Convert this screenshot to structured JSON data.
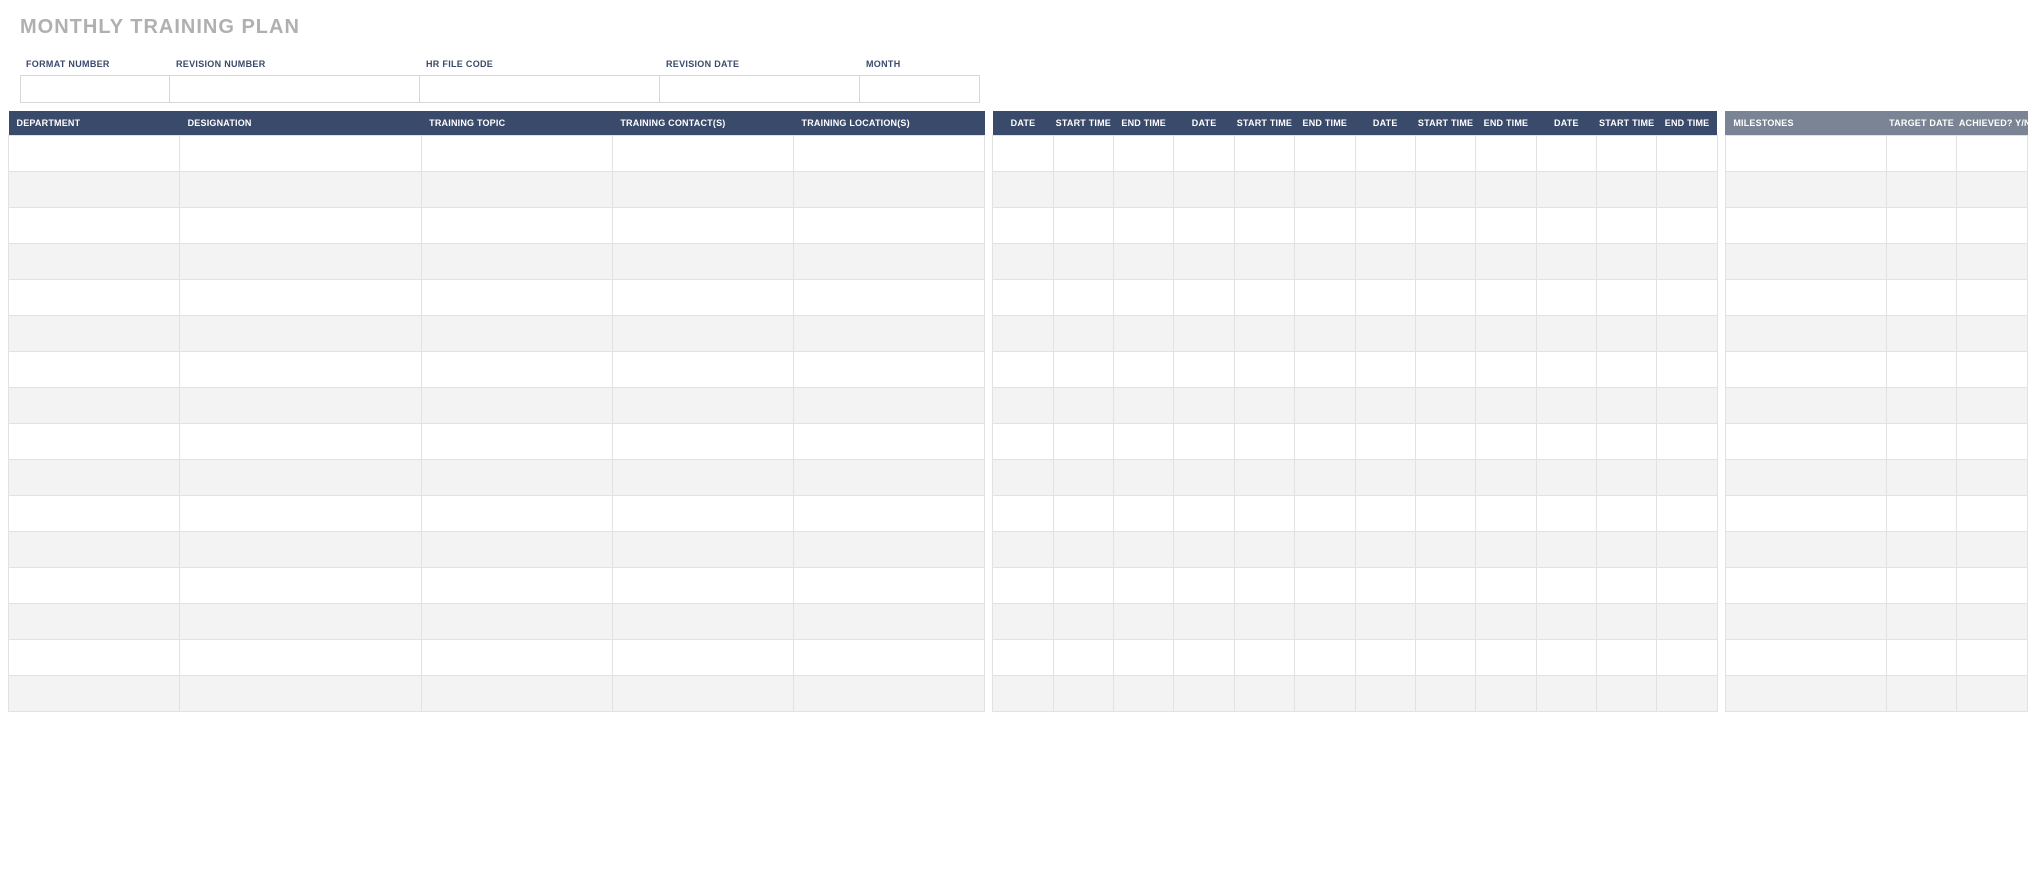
{
  "title": "MONTHLY TRAINING PLAN",
  "meta": {
    "format_number": {
      "label": "FORMAT NUMBER",
      "value": ""
    },
    "revision_number": {
      "label": "REVISION NUMBER",
      "value": ""
    },
    "hr_file_code": {
      "label": "HR FILE CODE",
      "value": ""
    },
    "revision_date": {
      "label": "REVISION DATE",
      "value": ""
    },
    "month": {
      "label": "MONTH",
      "value": ""
    }
  },
  "headers": {
    "department": "DEPARTMENT",
    "designation": "DESIGNATION",
    "training_topic": "TRAINING TOPIC",
    "training_contacts": "TRAINING CONTACT(S)",
    "training_locations": "TRAINING LOCATION(S)",
    "date": "DATE",
    "start_time": "START TIME",
    "end_time": "END TIME",
    "milestones": "MILESTONES",
    "target_date": "TARGET DATE",
    "achieved": "ACHIEVED? Y/N"
  },
  "week_blocks": 4,
  "rows": [
    {
      "department": "",
      "designation": "",
      "training_topic": "",
      "training_contacts": "",
      "training_locations": "",
      "weeks": [
        {
          "date": "",
          "start": "",
          "end": ""
        },
        {
          "date": "",
          "start": "",
          "end": ""
        },
        {
          "date": "",
          "start": "",
          "end": ""
        },
        {
          "date": "",
          "start": "",
          "end": ""
        }
      ],
      "milestones": "",
      "target_date": "",
      "achieved": ""
    },
    {
      "department": "",
      "designation": "",
      "training_topic": "",
      "training_contacts": "",
      "training_locations": "",
      "weeks": [
        {
          "date": "",
          "start": "",
          "end": ""
        },
        {
          "date": "",
          "start": "",
          "end": ""
        },
        {
          "date": "",
          "start": "",
          "end": ""
        },
        {
          "date": "",
          "start": "",
          "end": ""
        }
      ],
      "milestones": "",
      "target_date": "",
      "achieved": ""
    },
    {
      "department": "",
      "designation": "",
      "training_topic": "",
      "training_contacts": "",
      "training_locations": "",
      "weeks": [
        {
          "date": "",
          "start": "",
          "end": ""
        },
        {
          "date": "",
          "start": "",
          "end": ""
        },
        {
          "date": "",
          "start": "",
          "end": ""
        },
        {
          "date": "",
          "start": "",
          "end": ""
        }
      ],
      "milestones": "",
      "target_date": "",
      "achieved": ""
    },
    {
      "department": "",
      "designation": "",
      "training_topic": "",
      "training_contacts": "",
      "training_locations": "",
      "weeks": [
        {
          "date": "",
          "start": "",
          "end": ""
        },
        {
          "date": "",
          "start": "",
          "end": ""
        },
        {
          "date": "",
          "start": "",
          "end": ""
        },
        {
          "date": "",
          "start": "",
          "end": ""
        }
      ],
      "milestones": "",
      "target_date": "",
      "achieved": ""
    },
    {
      "department": "",
      "designation": "",
      "training_topic": "",
      "training_contacts": "",
      "training_locations": "",
      "weeks": [
        {
          "date": "",
          "start": "",
          "end": ""
        },
        {
          "date": "",
          "start": "",
          "end": ""
        },
        {
          "date": "",
          "start": "",
          "end": ""
        },
        {
          "date": "",
          "start": "",
          "end": ""
        }
      ],
      "milestones": "",
      "target_date": "",
      "achieved": ""
    },
    {
      "department": "",
      "designation": "",
      "training_topic": "",
      "training_contacts": "",
      "training_locations": "",
      "weeks": [
        {
          "date": "",
          "start": "",
          "end": ""
        },
        {
          "date": "",
          "start": "",
          "end": ""
        },
        {
          "date": "",
          "start": "",
          "end": ""
        },
        {
          "date": "",
          "start": "",
          "end": ""
        }
      ],
      "milestones": "",
      "target_date": "",
      "achieved": ""
    },
    {
      "department": "",
      "designation": "",
      "training_topic": "",
      "training_contacts": "",
      "training_locations": "",
      "weeks": [
        {
          "date": "",
          "start": "",
          "end": ""
        },
        {
          "date": "",
          "start": "",
          "end": ""
        },
        {
          "date": "",
          "start": "",
          "end": ""
        },
        {
          "date": "",
          "start": "",
          "end": ""
        }
      ],
      "milestones": "",
      "target_date": "",
      "achieved": ""
    },
    {
      "department": "",
      "designation": "",
      "training_topic": "",
      "training_contacts": "",
      "training_locations": "",
      "weeks": [
        {
          "date": "",
          "start": "",
          "end": ""
        },
        {
          "date": "",
          "start": "",
          "end": ""
        },
        {
          "date": "",
          "start": "",
          "end": ""
        },
        {
          "date": "",
          "start": "",
          "end": ""
        }
      ],
      "milestones": "",
      "target_date": "",
      "achieved": ""
    },
    {
      "department": "",
      "designation": "",
      "training_topic": "",
      "training_contacts": "",
      "training_locations": "",
      "weeks": [
        {
          "date": "",
          "start": "",
          "end": ""
        },
        {
          "date": "",
          "start": "",
          "end": ""
        },
        {
          "date": "",
          "start": "",
          "end": ""
        },
        {
          "date": "",
          "start": "",
          "end": ""
        }
      ],
      "milestones": "",
      "target_date": "",
      "achieved": ""
    },
    {
      "department": "",
      "designation": "",
      "training_topic": "",
      "training_contacts": "",
      "training_locations": "",
      "weeks": [
        {
          "date": "",
          "start": "",
          "end": ""
        },
        {
          "date": "",
          "start": "",
          "end": ""
        },
        {
          "date": "",
          "start": "",
          "end": ""
        },
        {
          "date": "",
          "start": "",
          "end": ""
        }
      ],
      "milestones": "",
      "target_date": "",
      "achieved": ""
    },
    {
      "department": "",
      "designation": "",
      "training_topic": "",
      "training_contacts": "",
      "training_locations": "",
      "weeks": [
        {
          "date": "",
          "start": "",
          "end": ""
        },
        {
          "date": "",
          "start": "",
          "end": ""
        },
        {
          "date": "",
          "start": "",
          "end": ""
        },
        {
          "date": "",
          "start": "",
          "end": ""
        }
      ],
      "milestones": "",
      "target_date": "",
      "achieved": ""
    },
    {
      "department": "",
      "designation": "",
      "training_topic": "",
      "training_contacts": "",
      "training_locations": "",
      "weeks": [
        {
          "date": "",
          "start": "",
          "end": ""
        },
        {
          "date": "",
          "start": "",
          "end": ""
        },
        {
          "date": "",
          "start": "",
          "end": ""
        },
        {
          "date": "",
          "start": "",
          "end": ""
        }
      ],
      "milestones": "",
      "target_date": "",
      "achieved": ""
    },
    {
      "department": "",
      "designation": "",
      "training_topic": "",
      "training_contacts": "",
      "training_locations": "",
      "weeks": [
        {
          "date": "",
          "start": "",
          "end": ""
        },
        {
          "date": "",
          "start": "",
          "end": ""
        },
        {
          "date": "",
          "start": "",
          "end": ""
        },
        {
          "date": "",
          "start": "",
          "end": ""
        }
      ],
      "milestones": "",
      "target_date": "",
      "achieved": ""
    },
    {
      "department": "",
      "designation": "",
      "training_topic": "",
      "training_contacts": "",
      "training_locations": "",
      "weeks": [
        {
          "date": "",
          "start": "",
          "end": ""
        },
        {
          "date": "",
          "start": "",
          "end": ""
        },
        {
          "date": "",
          "start": "",
          "end": ""
        },
        {
          "date": "",
          "start": "",
          "end": ""
        }
      ],
      "milestones": "",
      "target_date": "",
      "achieved": ""
    },
    {
      "department": "",
      "designation": "",
      "training_topic": "",
      "training_contacts": "",
      "training_locations": "",
      "weeks": [
        {
          "date": "",
          "start": "",
          "end": ""
        },
        {
          "date": "",
          "start": "",
          "end": ""
        },
        {
          "date": "",
          "start": "",
          "end": ""
        },
        {
          "date": "",
          "start": "",
          "end": ""
        }
      ],
      "milestones": "",
      "target_date": "",
      "achieved": ""
    },
    {
      "department": "",
      "designation": "",
      "training_topic": "",
      "training_contacts": "",
      "training_locations": "",
      "weeks": [
        {
          "date": "",
          "start": "",
          "end": ""
        },
        {
          "date": "",
          "start": "",
          "end": ""
        },
        {
          "date": "",
          "start": "",
          "end": ""
        },
        {
          "date": "",
          "start": "",
          "end": ""
        }
      ],
      "milestones": "",
      "target_date": "",
      "achieved": ""
    }
  ]
}
